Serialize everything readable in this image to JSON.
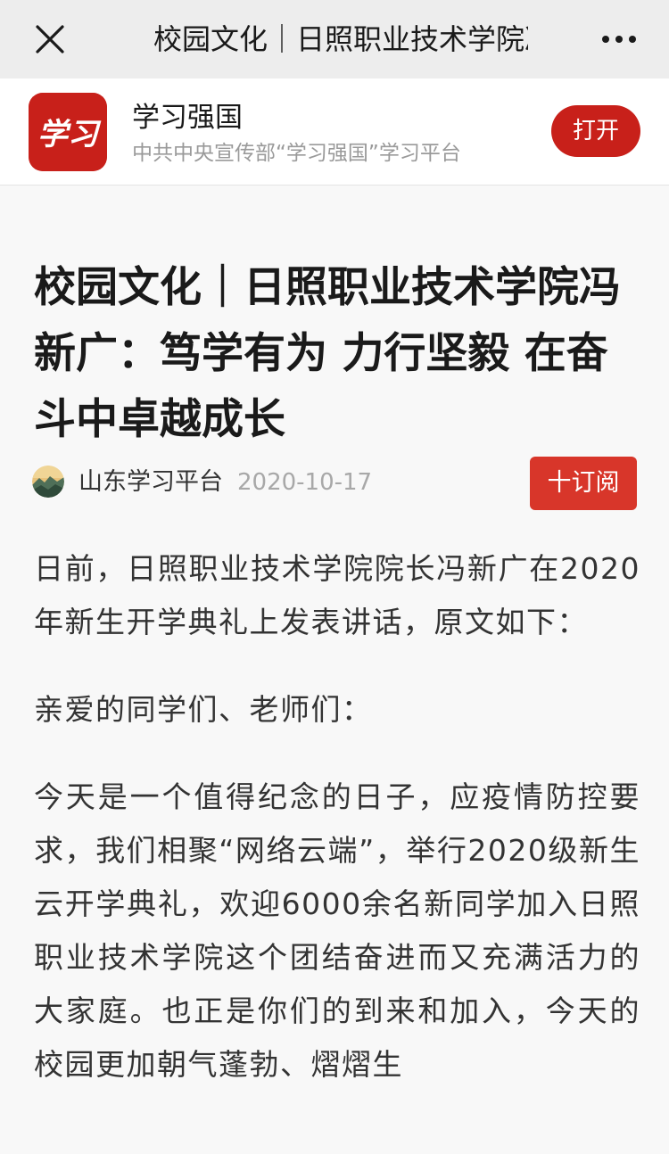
{
  "topbar": {
    "title": "校园文化｜日照职业技术学院冯新广：笃学有为 力行坚毅 在奋斗中卓越成长",
    "close_icon": "close-icon",
    "more_icon": "more-icon"
  },
  "app_banner": {
    "logo_text": "学习",
    "name": "学习强国",
    "description": "中共中央宣传部“学习强国”学习平台",
    "open_label": "打开",
    "brand_color": "#c8201a"
  },
  "article": {
    "title": "校园文化｜日照职业技术学院冯新广：笃学有为 力行坚毅 在奋斗中卓越成长",
    "source": "山东学习平台",
    "date": "2020-10-17",
    "subscribe_label": "十订阅",
    "paragraphs": [
      "日前，日照职业技术学院院长冯新广在2020年新生开学典礼上发表讲话，原文如下：",
      "亲爱的同学们、老师们：",
      "今天是一个值得纪念的日子，应疫情防控要求，我们相聚“网络云端”，举行2020级新生云开学典礼，欢迎6000余名新同学加入日照职业技术学院这个团结奋进而又充满活力的大家庭。也正是你们的到来和加入，今天的校园更加朝气蓬勃、熠熠生"
    ]
  }
}
